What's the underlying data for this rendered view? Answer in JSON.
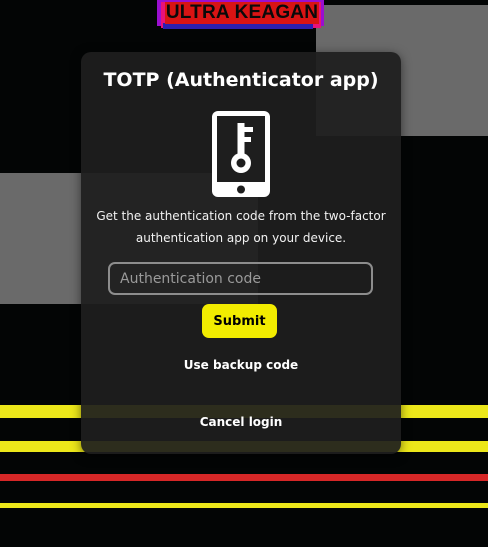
{
  "banner": {
    "text": "ULTRA KEAGAN"
  },
  "dialog": {
    "title": "TOTP (Authenticator app)",
    "icon": "smartphone-key-icon",
    "instructions": "Get the authentication code from the two-factor authentication app on your device.",
    "code_input": {
      "placeholder": "Authentication code",
      "value": ""
    },
    "submit_label": "Submit",
    "backup_label": "Use backup code",
    "cancel_label": "Cancel login"
  },
  "colors": {
    "accent": "#f2ec00",
    "dialog_bg": "#1e1e1e",
    "stripe_yellow": "#ece71a",
    "stripe_red": "#d62727"
  }
}
